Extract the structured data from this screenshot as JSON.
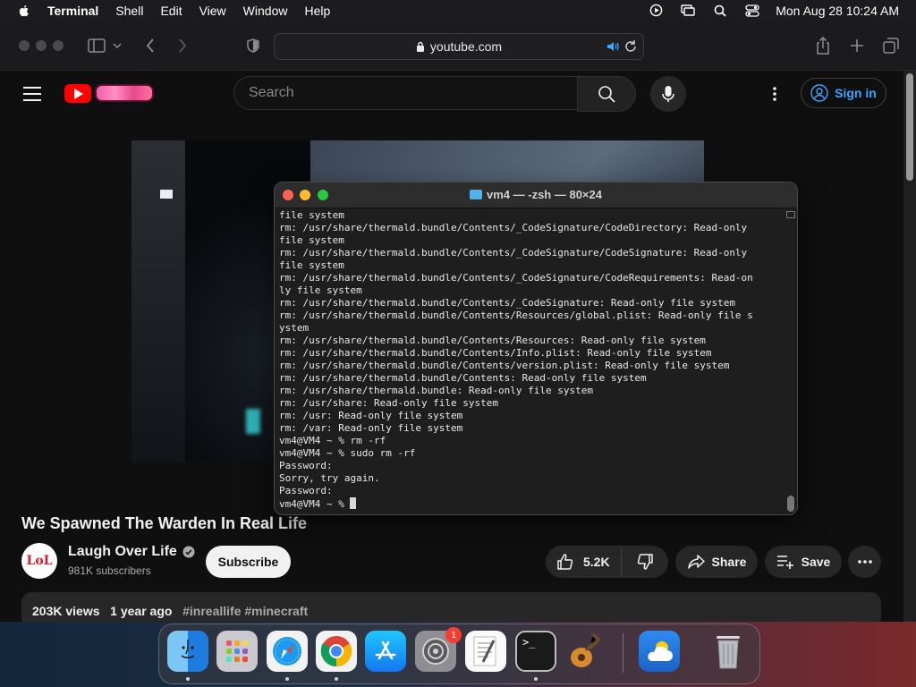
{
  "menubar": {
    "app_name": "Terminal",
    "menus": [
      "Shell",
      "Edit",
      "View",
      "Window",
      "Help"
    ],
    "clock": "Mon Aug 28  10:24 AM"
  },
  "browser": {
    "url": "youtube.com"
  },
  "youtube": {
    "search_placeholder": "Search",
    "sign_in": "Sign in",
    "video_title": "We Spawned The Warden In Real Life",
    "channel_name": "Laugh Over Life",
    "channel_avatar_text": "LoL",
    "subscribers": "981K subscribers",
    "subscribe": "Subscribe",
    "likes": "5.2K",
    "share": "Share",
    "save": "Save",
    "views": "203K views",
    "age": "1 year ago",
    "hashtags": "#inreallife #minecraft"
  },
  "terminal": {
    "title": "vm4 — -zsh — 80×24",
    "lines": [
      "file system",
      "rm: /usr/share/thermald.bundle/Contents/_CodeSignature/CodeDirectory: Read-only",
      "file system",
      "rm: /usr/share/thermald.bundle/Contents/_CodeSignature/CodeSignature: Read-only",
      "file system",
      "rm: /usr/share/thermald.bundle/Contents/_CodeSignature/CodeRequirements: Read-on",
      "ly file system",
      "rm: /usr/share/thermald.bundle/Contents/_CodeSignature: Read-only file system",
      "rm: /usr/share/thermald.bundle/Contents/Resources/global.plist: Read-only file s",
      "ystem",
      "rm: /usr/share/thermald.bundle/Contents/Resources: Read-only file system",
      "rm: /usr/share/thermald.bundle/Contents/Info.plist: Read-only file system",
      "rm: /usr/share/thermald.bundle/Contents/version.plist: Read-only file system",
      "rm: /usr/share/thermald.bundle/Contents: Read-only file system",
      "rm: /usr/share/thermald.bundle: Read-only file system",
      "rm: /usr/share: Read-only file system",
      "rm: /usr: Read-only file system",
      "rm: /var: Read-only file system",
      "vm4@VM4 ~ % rm -rf",
      "vm4@VM4 ~ % sudo rm -rf",
      "Password:",
      "Sorry, try again.",
      "Password:",
      "vm4@VM4 ~ % "
    ]
  },
  "dock": {
    "apps": [
      "finder-icon",
      "launchpad-icon",
      "safari-icon",
      "chrome-icon",
      "app-store-icon",
      "system-settings-icon",
      "textedit-icon",
      "terminal-icon",
      "garageband-icon",
      "weather-icon",
      "trash-icon"
    ],
    "settings_badge": "1",
    "terminal_prompt": ">_"
  }
}
